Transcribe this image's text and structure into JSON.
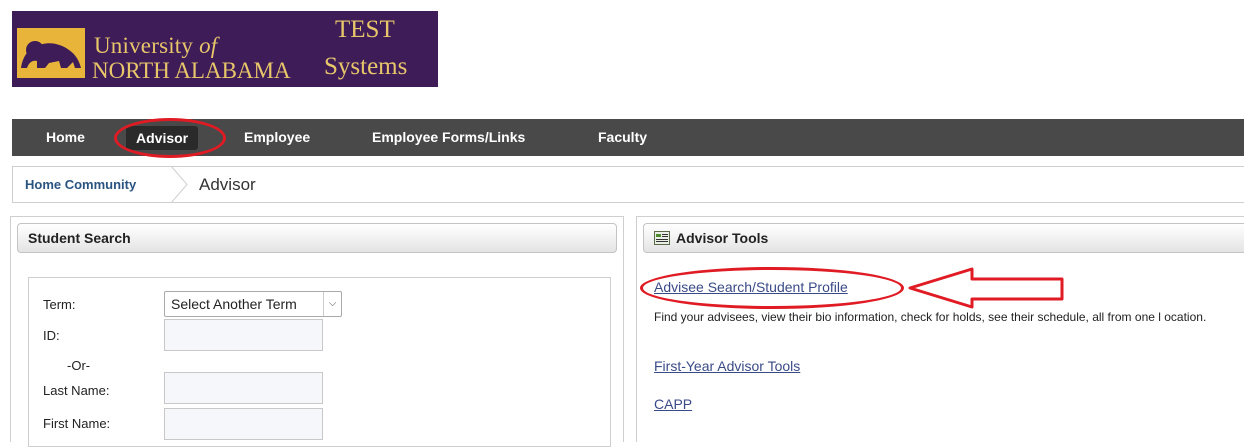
{
  "header": {
    "univ_line1_prefix": "University ",
    "univ_line1_italic": "of",
    "univ_line2": "NORTH ALABAMA",
    "env_line1": "TEST",
    "env_line2": "Systems",
    "logo_icon": "lion-icon"
  },
  "nav": {
    "items": [
      {
        "label": "Home"
      },
      {
        "label": "Advisor",
        "active": true
      },
      {
        "label": "Employee"
      },
      {
        "label": "Employee Forms/Links"
      },
      {
        "label": "Faculty"
      }
    ]
  },
  "breadcrumb": {
    "home": "Home Community",
    "current": "Advisor"
  },
  "student_search": {
    "title": "Student Search",
    "term_label": "Term:",
    "term_value": "Select Another Term",
    "id_label": "ID:",
    "or_label": "-Or-",
    "last_name_label": "Last Name:",
    "first_name_label": "First Name:"
  },
  "advisor_tools": {
    "title": "Advisor Tools",
    "links": [
      {
        "label": "Advisee Search/Student Profile"
      },
      {
        "label": "First-Year  Advisor Tools"
      },
      {
        "label": "CAPP"
      }
    ],
    "description": "Find your advisees, view their bio information, check for holds, see their schedule, all from one l ocation."
  },
  "annotation_color": "#e01b24"
}
